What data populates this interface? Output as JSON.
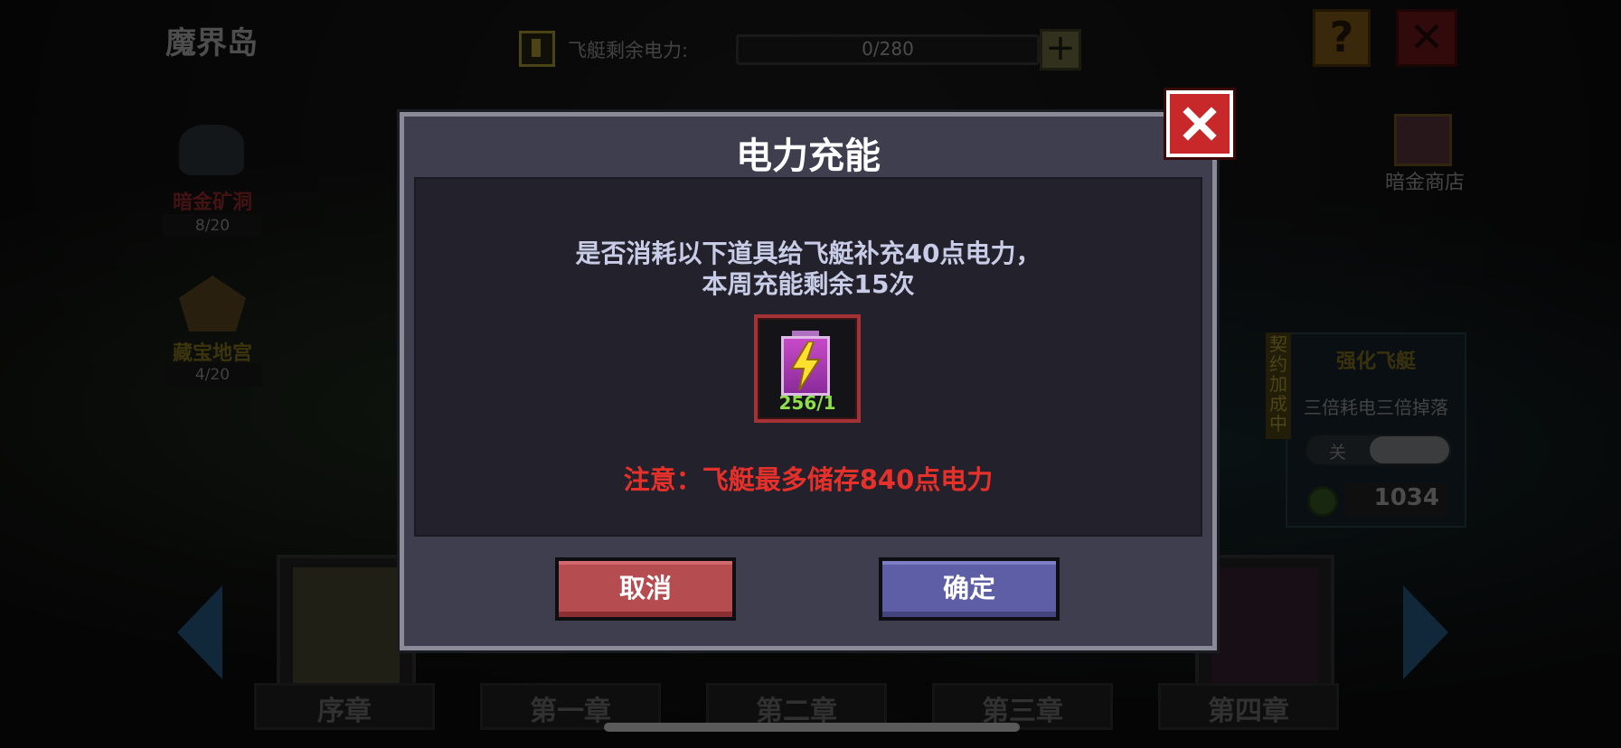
{
  "header": {
    "map_title": "魔界岛",
    "power_label": "飞艇剩余电力:",
    "power_value": "0/280",
    "power_plus": "+",
    "help": "?",
    "close": "✕"
  },
  "landmarks": [
    {
      "label": "暗金矿洞",
      "count": "8/20"
    },
    {
      "label": "藏宝地宫",
      "count": "4/20"
    }
  ],
  "right_panel": {
    "shop_label": "暗金商店",
    "boost_tag": "契约加成中",
    "boost_title": "强化飞艇",
    "boost_desc": "三倍耗电三倍掉落",
    "toggle_off": "关",
    "currency": "1034"
  },
  "chapters": [
    "序章",
    "第一章",
    "第二章",
    "第三章",
    "第四章"
  ],
  "dialog": {
    "title": "电力充能",
    "message_line1": "是否消耗以下道具给飞艇补充40点电力，",
    "message_line2": "本周充能剩余15次",
    "item_count": "256/1",
    "warning": "注意：飞艇最多储存840点电力",
    "cancel": "取消",
    "confirm": "确定"
  },
  "colors": {
    "warning": "#e8302a",
    "cancel_button": "#b44c50",
    "confirm_button": "#5e5ea6",
    "close_button": "#c8282a",
    "item_count": "#8ee04a"
  },
  "icons": [
    "battery-icon",
    "lightning-bolt-icon",
    "close-icon",
    "help-icon",
    "treasure-chest-icon",
    "power-cell-icon"
  ]
}
